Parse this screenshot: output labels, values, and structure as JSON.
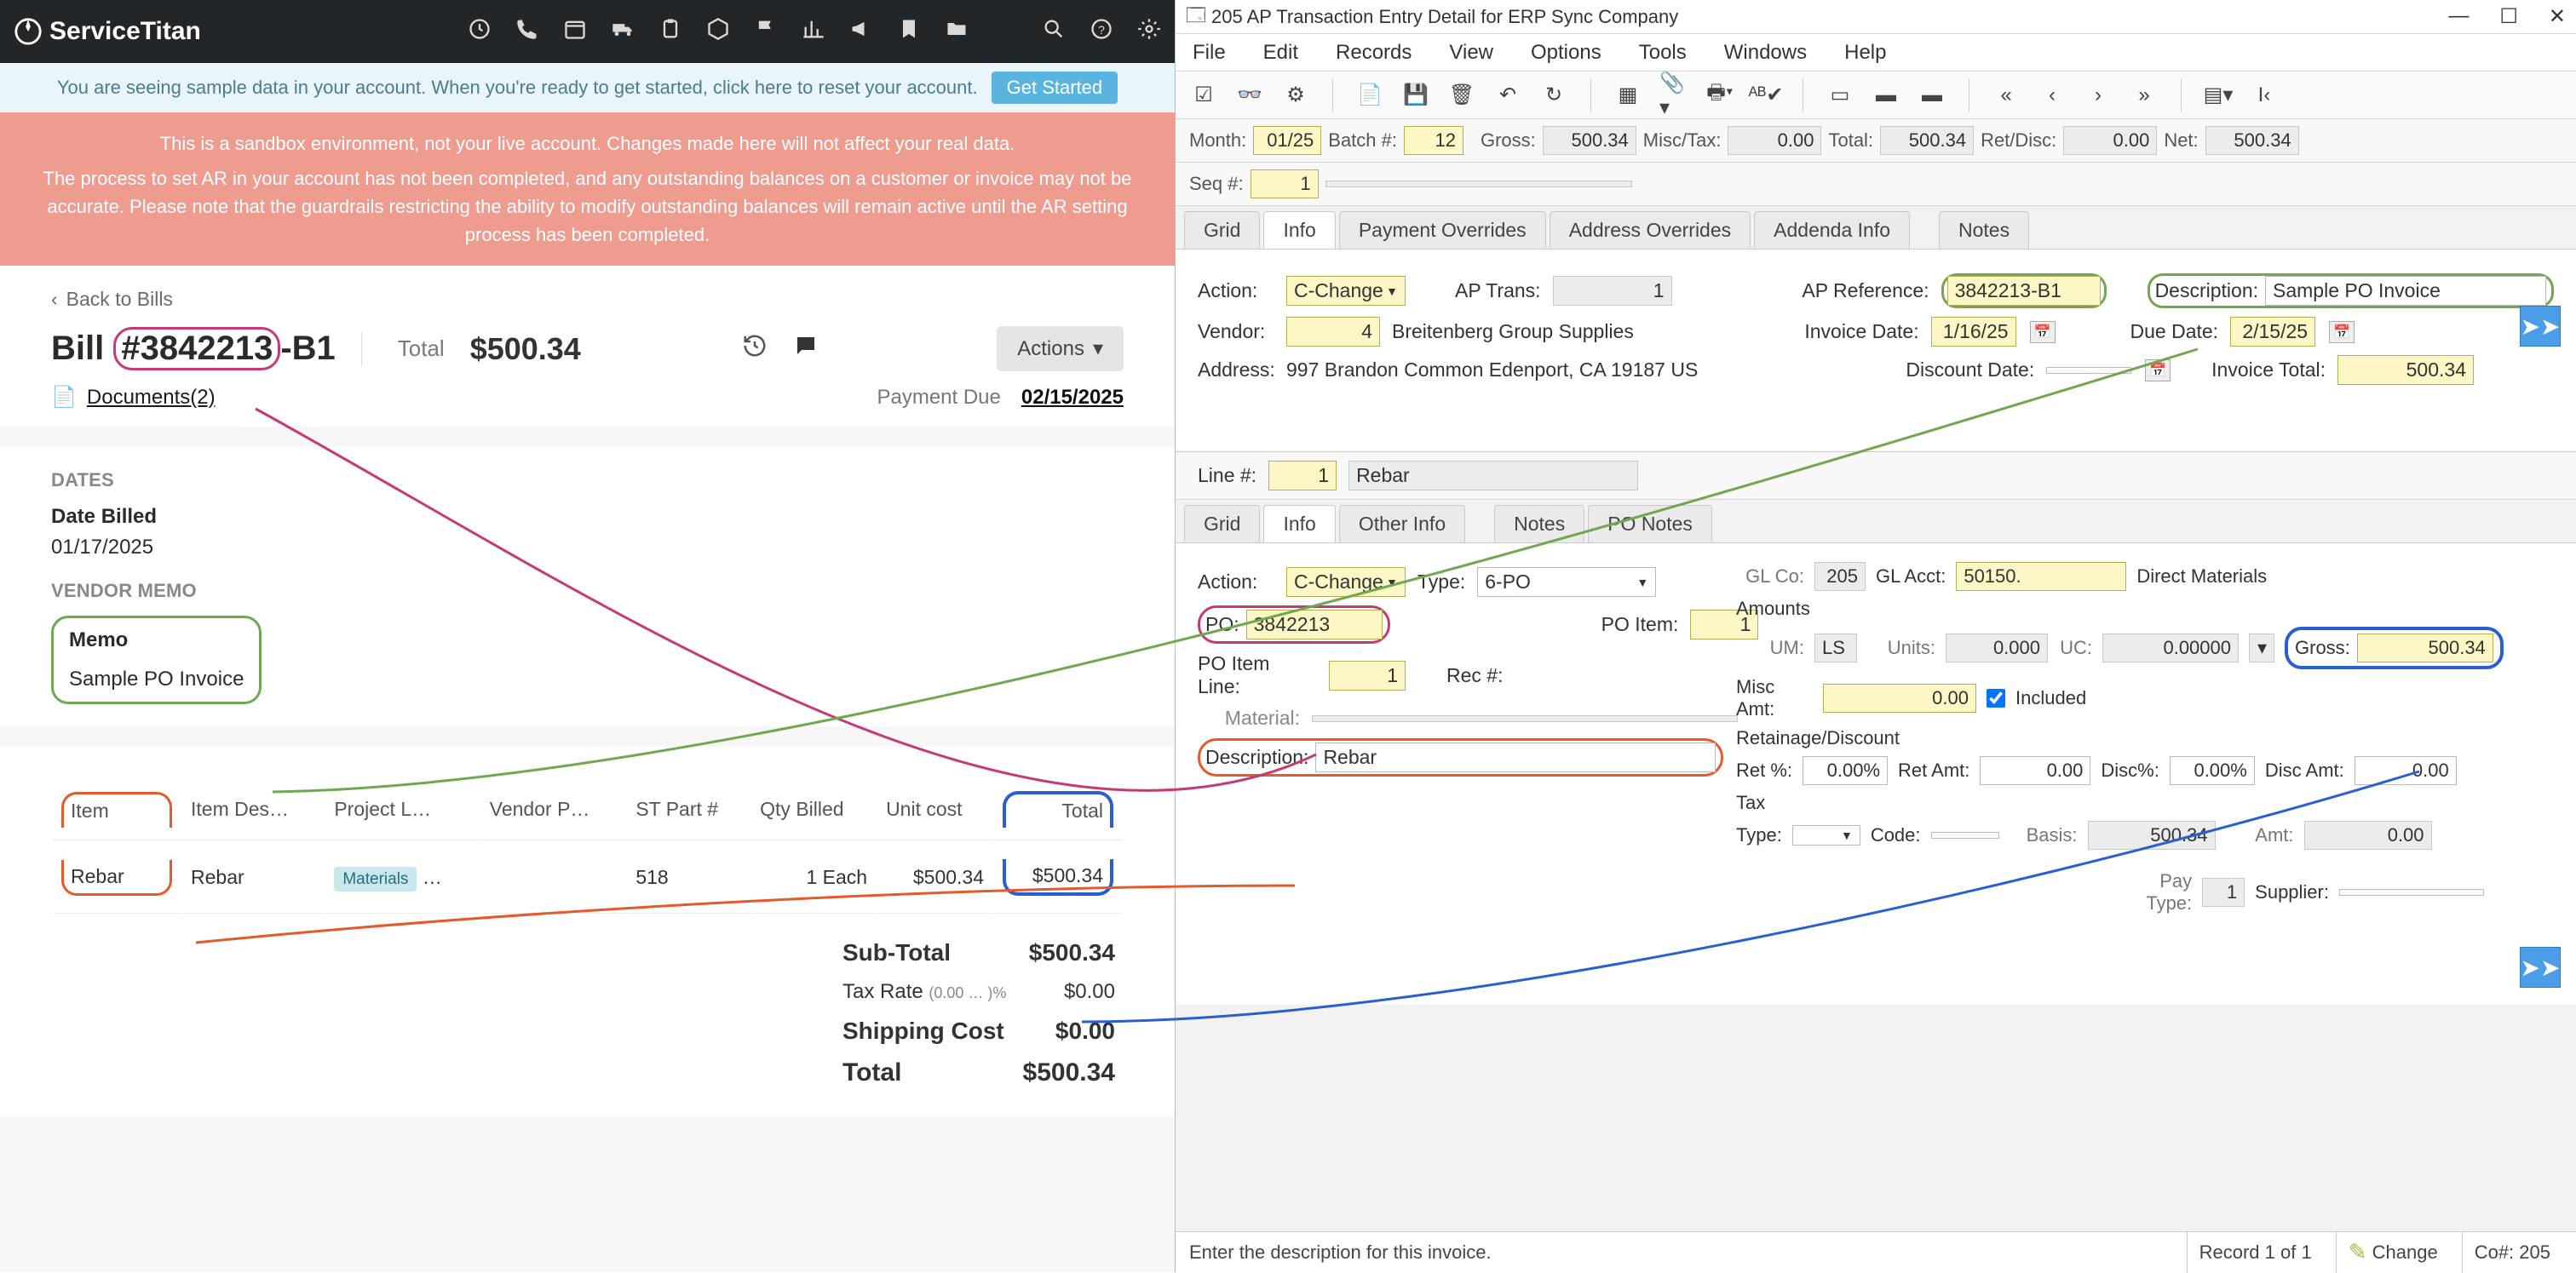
{
  "st": {
    "brand": "ServiceTitan",
    "infobar": "You are seeing sample data in your account. When you're ready to get started, click here to reset your account.",
    "get_started": "Get Started",
    "warn1": "This is a sandbox environment, not your live account. Changes made here will not affect your real data.",
    "warn2": "The process to set AR in your account has not been completed, and any outstanding balances on a customer or invoice may not be accurate. Please note that the guardrails restricting the ability to modify outstanding balances will remain active until the AR setting process has been completed.",
    "back": "Back to Bills",
    "bill_prefix": "Bill ",
    "bill_po": "#3842213",
    "bill_suffix": "-B1",
    "total_label": "Total",
    "total_value": "$500.34",
    "actions": "Actions",
    "documents": "Documents(2)",
    "paydue_label": "Payment Due",
    "paydue_date": "02/15/2025",
    "dates_label": "DATES",
    "datebilled_label": "Date Billed",
    "datebilled_value": "01/17/2025",
    "vendormemo_label": "VENDOR MEMO",
    "memo_label": "Memo",
    "memo_value": "Sample PO Invoice",
    "table": {
      "headers": [
        "Item",
        "Item Des…",
        "Project L…",
        "Vendor P…",
        "ST Part #",
        "Qty Billed",
        "Unit cost",
        "Total"
      ],
      "row": {
        "item": "Rebar",
        "desc": "Rebar",
        "project_badge": "Materials",
        "project_more": "…",
        "vendor": "",
        "stpart": "518",
        "qty": "1 Each",
        "unit": "$500.34",
        "total": "$500.34"
      }
    },
    "totals": {
      "sub_label": "Sub-Total",
      "sub": "$500.34",
      "tax_label": "Tax Rate",
      "tax_note": "(0.00 … )%",
      "tax": "$0.00",
      "ship_label": "Shipping Cost",
      "ship": "$0.00",
      "tot_label": "Total",
      "tot": "$500.34"
    }
  },
  "erp": {
    "title": "205 AP Transaction Entry Detail for ERP Sync Company",
    "menus": [
      "File",
      "Edit",
      "Records",
      "View",
      "Options",
      "Tools",
      "Windows",
      "Help"
    ],
    "totals_row": {
      "month_l": "Month:",
      "month": "01/25",
      "batch_l": "Batch #:",
      "batch": "12",
      "gross_l": "Gross:",
      "gross": "500.34",
      "misc_l": "Misc/Tax:",
      "misc": "0.00",
      "total_l": "Total:",
      "total": "500.34",
      "ret_l": "Ret/Disc:",
      "ret": "0.00",
      "net_l": "Net:",
      "net": "500.34"
    },
    "seq_l": "Seq #:",
    "seq": "1",
    "tabs_top": [
      "Grid",
      "Info",
      "Payment Overrides",
      "Address Overrides",
      "Addenda Info",
      "Notes"
    ],
    "form_top": {
      "action_l": "Action:",
      "action": "C-Change",
      "aptrans_l": "AP Trans:",
      "aptrans": "1",
      "apref_l": "AP Reference:",
      "apref": "3842213-B1",
      "desc_l": "Description:",
      "desc": "Sample PO Invoice",
      "vendor_l": "Vendor:",
      "vendor": "4",
      "vendor_name": "Breitenberg Group Supplies",
      "invdate_l": "Invoice Date:",
      "invdate": "1/16/25",
      "duedate_l": "Due Date:",
      "duedate": "2/15/25",
      "addr_l": "Address:",
      "addr": "997 Brandon Common  Edenport,  CA  19187  US",
      "discdate_l": "Discount Date:",
      "discdate": "",
      "invtot_l": "Invoice Total:",
      "invtot": "500.34"
    },
    "line": {
      "line_l": "Line #:",
      "line": "1",
      "line_name": "Rebar"
    },
    "tabs_mid": [
      "Grid",
      "Info",
      "Other Info",
      "Notes",
      "PO Notes"
    ],
    "form_bot": {
      "action_l": "Action:",
      "action": "C-Change",
      "type_l": "Type:",
      "type": "6-PO",
      "glco_l": "GL Co:",
      "glco": "205",
      "glacc_l": "GL Acct:",
      "glacc": "50150.",
      "glacc_name": "Direct Materials",
      "po_l": "PO:",
      "po": "3842213",
      "poitem_l": "PO Item:",
      "poitem": "1",
      "poiline_l": "PO Item Line:",
      "poiline": "1",
      "rec_l": "Rec #:",
      "mat_l": "Material:",
      "desc_l": "Description:",
      "desc": "Rebar"
    },
    "amounts": {
      "head": "Amounts",
      "um_l": "UM:",
      "um": "LS",
      "units_l": "Units:",
      "units": "0.000",
      "uc_l": "UC:",
      "uc": "0.00000",
      "gross_l": "Gross:",
      "gross": "500.34",
      "misc_l": "Misc Amt:",
      "misc": "0.00",
      "included": "Included",
      "retdisc": "Retainage/Discount",
      "retp_l": "Ret %:",
      "retp": "0.00%",
      "reta_l": "Ret Amt:",
      "reta": "0.00",
      "discp_l": "Disc%:",
      "discp": "0.00%",
      "disca_l": "Disc Amt:",
      "disca": "0.00",
      "tax": "Tax",
      "taxtype_l": "Type:",
      "code_l": "Code:",
      "basis_l": "Basis:",
      "basis": "500.34",
      "amt_l": "Amt:",
      "amt": "0.00",
      "paytype_l": "Pay Type:",
      "paytype": "1",
      "supplier_l": "Supplier:"
    },
    "status": {
      "hint": "Enter the description for this invoice.",
      "rec": "Record 1 of 1",
      "change": "Change",
      "co": "Co#: 205"
    }
  }
}
